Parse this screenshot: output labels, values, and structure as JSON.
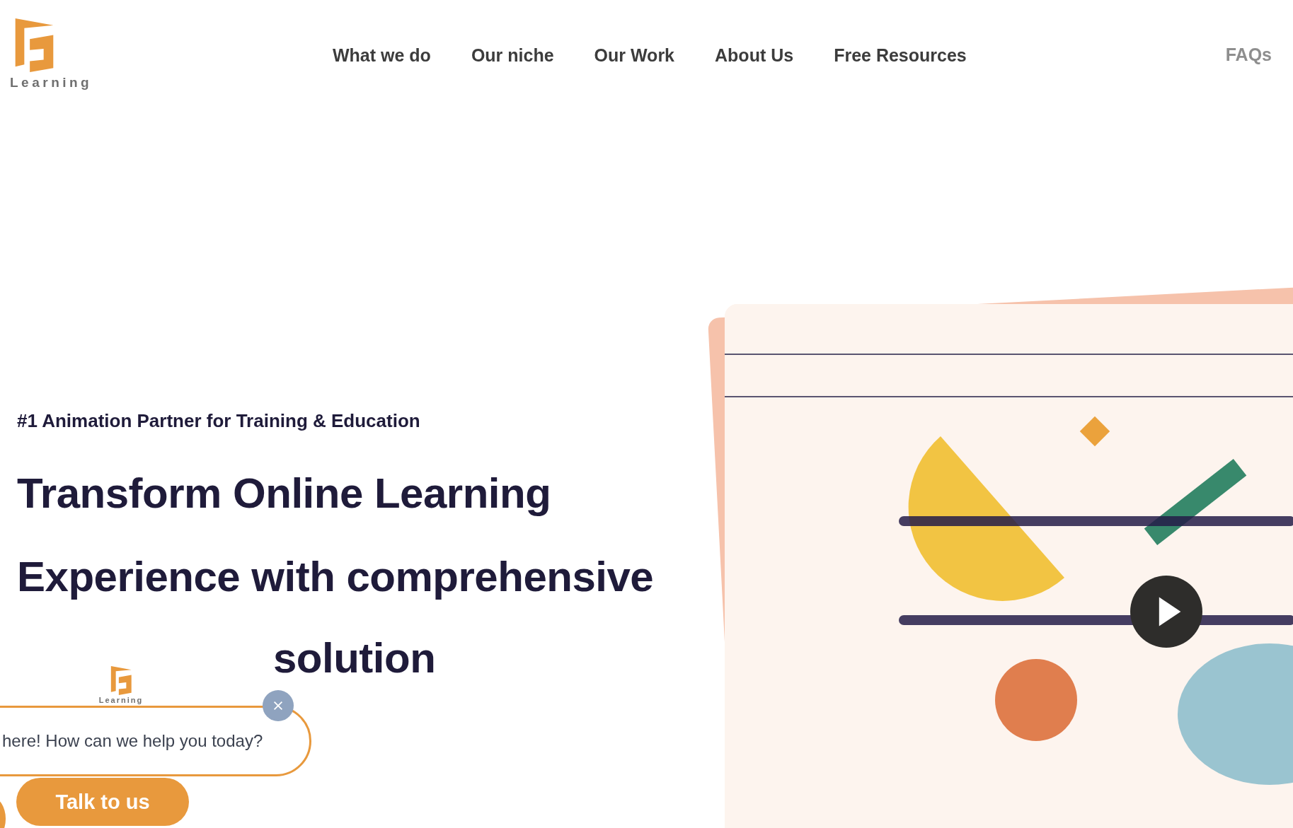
{
  "logo": {
    "wordmark": "Learning"
  },
  "nav": [
    {
      "label": "What we do",
      "kind": "main"
    },
    {
      "label": "Our niche",
      "kind": "main"
    },
    {
      "label": "Our Work",
      "kind": "main"
    },
    {
      "label": "About Us",
      "kind": "main"
    },
    {
      "label": "Free Resources",
      "kind": "main"
    },
    {
      "label": "FAQs",
      "kind": "muted"
    }
  ],
  "hero": {
    "tagline": "#1 Animation Partner for Training & Education",
    "heading_lines": [
      "Transform Online Learning",
      "Experience with comprehensive"
    ],
    "heading_tail": "solution"
  },
  "chat": {
    "logo_wordmark": "Learning",
    "message": "here! How can we help you today?",
    "button": "Talk to us"
  }
}
